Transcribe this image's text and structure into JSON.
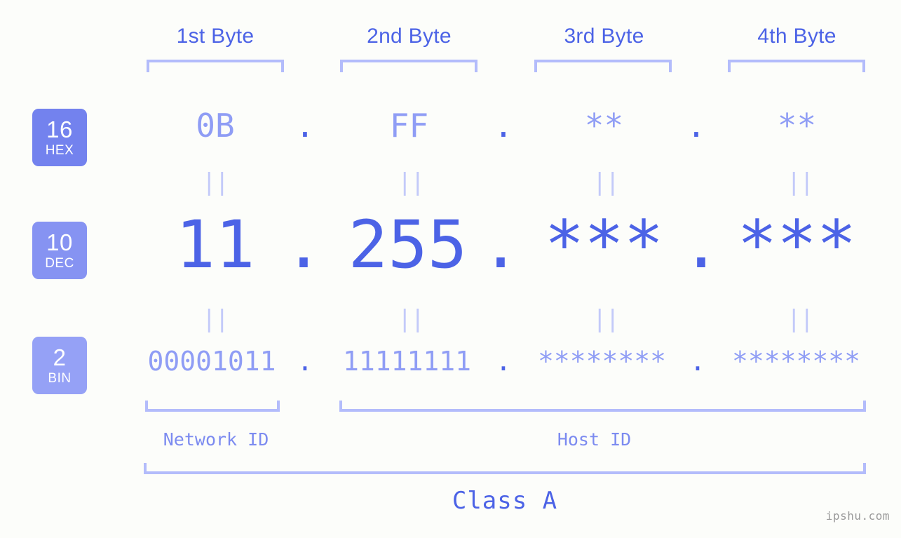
{
  "watermark": "ipshu.com",
  "colors": {
    "background": "#fcfdfa",
    "accent_strong": "#4c63e6",
    "accent_light": "#8f9df5",
    "bracket": "#b3bcfb",
    "connector": "#c3caf9",
    "badge_hex": "#7382ee",
    "badge_dec": "#8693f2",
    "badge_bin": "#95a1f6"
  },
  "byte_headers": [
    {
      "label": "1st Byte"
    },
    {
      "label": "2nd Byte"
    },
    {
      "label": "3rd Byte"
    },
    {
      "label": "4th Byte"
    }
  ],
  "rows": [
    {
      "id": "hex",
      "badge_number": "16",
      "badge_name": "HEX",
      "values": [
        "0B",
        "FF",
        "**",
        "**"
      ],
      "separator": "."
    },
    {
      "id": "dec",
      "badge_number": "10",
      "badge_name": "DEC",
      "values": [
        "11",
        "255",
        "***",
        "***"
      ],
      "separator": "."
    },
    {
      "id": "bin",
      "badge_number": "2",
      "badge_name": "BIN",
      "values": [
        "00001011",
        "11111111",
        "********",
        "********"
      ],
      "separator": "."
    }
  ],
  "connector_symbol": "||",
  "footer": {
    "network_id": "Network ID",
    "host_id": "Host ID",
    "class": "Class A"
  }
}
